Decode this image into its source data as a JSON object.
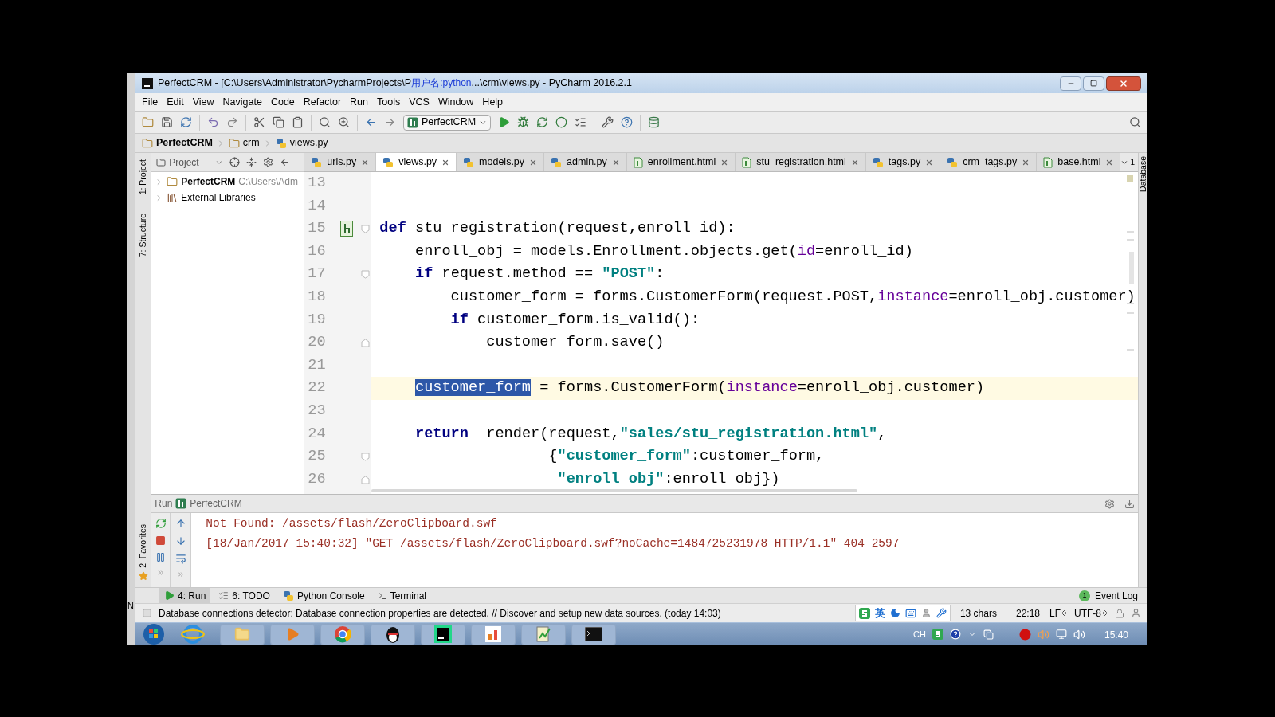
{
  "background_window": {
    "text": "N"
  },
  "window": {
    "title": "PerfectCRM - [C:\\Users\\Administrator\\PycharmProjects\\P",
    "title_overlay": "用户名:python",
    "title_end": "...\\crm\\views.py - PyCharm 2016.2.1"
  },
  "menu": [
    "File",
    "Edit",
    "View",
    "Navigate",
    "Code",
    "Refactor",
    "Run",
    "Tools",
    "VCS",
    "Window",
    "Help"
  ],
  "toolbar": {
    "run_config": "PerfectCRM"
  },
  "breadcrumb": [
    {
      "label": "PerfectCRM",
      "kind": "project"
    },
    {
      "label": "crm",
      "kind": "folder"
    },
    {
      "label": "views.py",
      "kind": "py"
    }
  ],
  "left_stripe": {
    "top": [
      "1: Project",
      "7: Structure"
    ],
    "bottom": [
      "2: Favorites"
    ]
  },
  "right_stripe": {
    "label": "Database"
  },
  "project_panel": {
    "title": "Project",
    "tree": [
      {
        "name": "PerfectCRM",
        "path": "C:\\Users\\Adm",
        "kind": "project",
        "expanded": false
      },
      {
        "name": "External Libraries",
        "kind": "libraries",
        "expanded": false
      }
    ]
  },
  "editor_tabs": [
    {
      "label": "urls.py",
      "kind": "py",
      "selected": false
    },
    {
      "label": "views.py",
      "kind": "py",
      "selected": true
    },
    {
      "label": "models.py",
      "kind": "py",
      "selected": false
    },
    {
      "label": "admin.py",
      "kind": "py",
      "selected": false
    },
    {
      "label": "enrollment.html",
      "kind": "html",
      "selected": false
    },
    {
      "label": "stu_registration.html",
      "kind": "html",
      "selected": false
    },
    {
      "label": "tags.py",
      "kind": "py",
      "selected": false
    },
    {
      "label": "crm_tags.py",
      "kind": "py",
      "selected": false
    },
    {
      "label": "base.html",
      "kind": "html",
      "selected": false
    }
  ],
  "tab_overflow": "1",
  "editor": {
    "lines": [
      {
        "number": "13",
        "current": false
      },
      {
        "number": "14",
        "current": false
      },
      {
        "number": "15",
        "current": false,
        "gutter": {
          "kind": "template"
        },
        "fold": {
          "kind": "start"
        },
        "tokens": [
          {
            "text": "def",
            "kind": "kw"
          },
          {
            "text": " stu_registration(request,enroll_id):",
            "kind": "plain"
          }
        ]
      },
      {
        "number": "16",
        "current": false,
        "tokens": [
          {
            "text": "    enroll_obj = models.Enrollment.objects.get(",
            "kind": "plain"
          },
          {
            "text": "id",
            "kind": "param"
          },
          {
            "text": "=enroll_id)",
            "kind": "plain"
          }
        ]
      },
      {
        "number": "17",
        "current": false,
        "fold": {
          "kind": "start"
        },
        "tokens": [
          {
            "text": "    if",
            "kind": "kw"
          },
          {
            "text": " request.method == ",
            "kind": "plain"
          },
          {
            "text": "\"POST\"",
            "kind": "str"
          },
          {
            "text": ":",
            "kind": "plain"
          }
        ]
      },
      {
        "number": "18",
        "current": false,
        "tokens": [
          {
            "text": "        customer_form = forms.CustomerForm(request.POST,",
            "kind": "plain"
          },
          {
            "text": "instance",
            "kind": "param"
          },
          {
            "text": "=enroll_obj.customer)",
            "kind": "plain"
          }
        ]
      },
      {
        "number": "19",
        "current": false,
        "tokens": [
          {
            "text": "        if",
            "kind": "kw"
          },
          {
            "text": " customer_form.is_valid():",
            "kind": "plain"
          }
        ]
      },
      {
        "number": "20",
        "current": false,
        "fold": {
          "kind": "end"
        },
        "tokens": [
          {
            "text": "            customer_form.save()",
            "kind": "plain"
          }
        ]
      },
      {
        "number": "21",
        "current": false
      },
      {
        "number": "22",
        "current": true,
        "tokens": [
          {
            "text": "    customer_form",
            "kind": "selection"
          },
          {
            "text": " = forms.CustomerForm(",
            "kind": "plain"
          },
          {
            "text": "instance",
            "kind": "param"
          },
          {
            "text": "=enroll_obj.customer)",
            "kind": "plain"
          }
        ]
      },
      {
        "number": "23",
        "current": false
      },
      {
        "number": "24",
        "current": false,
        "tokens": [
          {
            "text": "    return",
            "kind": "kw"
          },
          {
            "text": "  render(request,",
            "kind": "plain"
          },
          {
            "text": "\"sales/stu_registration.html\"",
            "kind": "str"
          },
          {
            "text": ",",
            "kind": "plain"
          }
        ]
      },
      {
        "number": "25",
        "current": false,
        "fold": {
          "kind": "start"
        },
        "tokens": [
          {
            "text": "                   {",
            "kind": "plain"
          },
          {
            "text": "\"customer_form\"",
            "kind": "str"
          },
          {
            "text": ":customer_form,",
            "kind": "plain"
          }
        ]
      },
      {
        "number": "26",
        "current": false,
        "fold": {
          "kind": "end"
        },
        "tokens": [
          {
            "text": "                    \"enroll_obj\"",
            "kind": "str"
          },
          {
            "text": ":enroll_obj})",
            "kind": "plain"
          }
        ]
      }
    ]
  },
  "run_panel": {
    "title": "Run",
    "config": "PerfectCRM",
    "output": [
      "Not Found: /assets/flash/ZeroClipboard.swf",
      "[18/Jan/2017 15:40:32] \"GET /assets/flash/ZeroClipboard.swf?noCache=1484725231978 HTTP/1.1\" 404 2597"
    ]
  },
  "tool_window_bar": [
    {
      "label": "4: Run",
      "kind": "run",
      "selected": true
    },
    {
      "label": "6: TODO",
      "kind": "todo",
      "selected": false
    },
    {
      "label": "Python Console",
      "kind": "console",
      "selected": false
    },
    {
      "label": "Terminal",
      "kind": "terminal",
      "selected": false
    }
  ],
  "event_log": {
    "label": "Event Log",
    "count": "1"
  },
  "status_bar": {
    "message": "Database connections detector: Database connection properties are detected. // Discover and setup new data sources. (today 14:03)",
    "ime_mode": "英",
    "chars": "13 chars",
    "position": "22:18",
    "line_separator": "LF",
    "encoding": "UTF-8"
  },
  "taskbar": {
    "language": "CH",
    "time": "15:40"
  }
}
